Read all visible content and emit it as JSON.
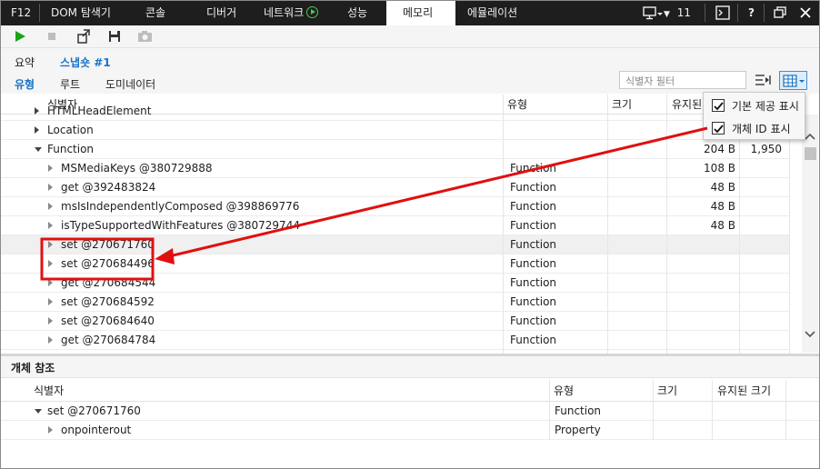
{
  "titlebar": {
    "f12": "F12",
    "tabs": [
      "DOM 탐색기",
      "콘솔",
      "디버거",
      "네트워크",
      "성능",
      "메모리",
      "에뮬레이션"
    ],
    "active_tab": "메모리",
    "error_count": "11",
    "help": "?"
  },
  "toolbar": {
    "icons": [
      "play-icon",
      "stop-icon",
      "import-icon",
      "save-icon",
      "camera-icon"
    ],
    "colors": {
      "play": "#1ea11e"
    }
  },
  "tabs_top": {
    "summary": "요약",
    "snapshot": "스냅숏 #1"
  },
  "tabs_bottom": {
    "types": "유형",
    "roots": "루트",
    "dominators": "도미네이터"
  },
  "filter": {
    "placeholder": "식별자 필터"
  },
  "columns": {
    "identifier": "식별자",
    "type": "유형",
    "size": "크기",
    "retained": "유지된",
    "count": ""
  },
  "popup": {
    "item1": "기본 제공 표시",
    "item2": "개체 ID 표시"
  },
  "rows": [
    {
      "name": "HTMLHeadElement",
      "type": "",
      "size": "",
      "retained": "",
      "count": "",
      "indent": 0,
      "state": "collapsed"
    },
    {
      "name": "Location",
      "type": "",
      "size": "",
      "retained": "",
      "count": "",
      "indent": 0,
      "state": "collapsed"
    },
    {
      "name": "Function",
      "type": "",
      "size": "",
      "retained": "204 B",
      "count": "1,950",
      "indent": 0,
      "state": "expanded"
    },
    {
      "name": "MSMediaKeys @380729888",
      "type": "Function",
      "size": "",
      "retained": "108 B",
      "count": "",
      "indent": 1,
      "state": "collapsed"
    },
    {
      "name": "get @392483824",
      "type": "Function",
      "size": "",
      "retained": "48 B",
      "count": "",
      "indent": 1,
      "state": "collapsed"
    },
    {
      "name": "msIsIndependentlyComposed @398869776",
      "type": "Function",
      "size": "",
      "retained": "48 B",
      "count": "",
      "indent": 1,
      "state": "collapsed"
    },
    {
      "name": "isTypeSupportedWithFeatures @380729744",
      "type": "Function",
      "size": "",
      "retained": "48 B",
      "count": "",
      "indent": 1,
      "state": "collapsed"
    },
    {
      "name": "set @270671760",
      "type": "Function",
      "size": "",
      "retained": "",
      "count": "",
      "indent": 1,
      "state": "collapsed",
      "highlight": true
    },
    {
      "name": "set @270684496",
      "type": "Function",
      "size": "",
      "retained": "",
      "count": "",
      "indent": 1,
      "state": "collapsed"
    },
    {
      "name": "get @270684544",
      "type": "Function",
      "size": "",
      "retained": "",
      "count": "",
      "indent": 1,
      "state": "collapsed"
    },
    {
      "name": "set @270684592",
      "type": "Function",
      "size": "",
      "retained": "",
      "count": "",
      "indent": 1,
      "state": "collapsed"
    },
    {
      "name": "set @270684640",
      "type": "Function",
      "size": "",
      "retained": "",
      "count": "",
      "indent": 1,
      "state": "collapsed"
    },
    {
      "name": "get @270684784",
      "type": "Function",
      "size": "",
      "retained": "",
      "count": "",
      "indent": 1,
      "state": "collapsed"
    }
  ],
  "bottom": {
    "title": "개체 참조",
    "columns": {
      "identifier": "식별자",
      "type": "유형",
      "size": "크기",
      "retained": "유지된 크기"
    },
    "rows": [
      {
        "name": "set @270671760",
        "type": "Function",
        "indent": 0,
        "state": "expanded"
      },
      {
        "name": "onpointerout",
        "type": "Property",
        "indent": 1,
        "state": "collapsed"
      }
    ]
  },
  "annotation": {
    "color": "#e01010"
  }
}
